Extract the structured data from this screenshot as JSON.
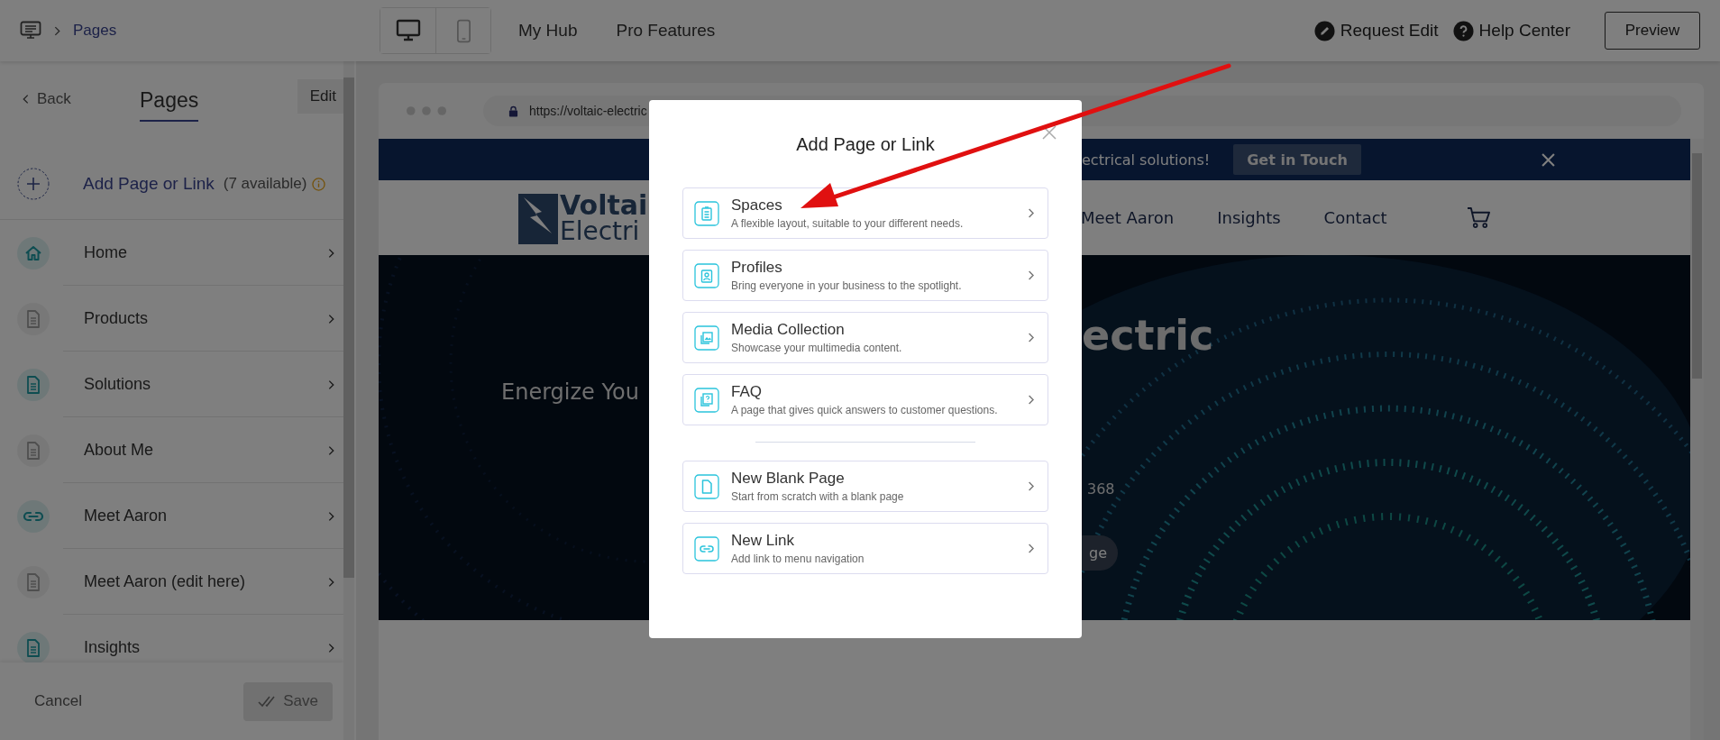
{
  "top_bar": {
    "breadcrumb_current": "Pages",
    "device_toggle": [
      {
        "kind": "desktop",
        "selected": true
      },
      {
        "kind": "mobile",
        "selected": false
      }
    ],
    "nav_links": [
      "My Hub",
      "Pro Features"
    ],
    "actions": [
      {
        "kind": "edit",
        "label": "Request Edit"
      },
      {
        "kind": "help",
        "label": "Help Center"
      }
    ],
    "preview_button": "Preview"
  },
  "sidebar": {
    "back": "Back",
    "title": "Pages",
    "edit_button": "Edit",
    "add_item": {
      "label": "Add Page or Link",
      "note": "(7 available)"
    },
    "items": [
      {
        "label": "Home",
        "kind": "home",
        "highlighted": true
      },
      {
        "label": "Products",
        "kind": "page",
        "highlighted": false
      },
      {
        "label": "Solutions",
        "kind": "page",
        "highlighted": true
      },
      {
        "label": "About Me",
        "kind": "page",
        "highlighted": false
      },
      {
        "label": "Meet Aaron",
        "kind": "link",
        "highlighted": true
      },
      {
        "label": "Meet Aaron (edit here)",
        "kind": "page",
        "highlighted": false
      },
      {
        "label": "Insights",
        "kind": "page",
        "highlighted": true
      }
    ],
    "cancel": "Cancel",
    "save": {
      "label": "Save",
      "disabled": true
    }
  },
  "preview": {
    "url": "https://voltaic-electric",
    "banner": {
      "text": "ectrical solutions!",
      "button": "Get in Touch"
    },
    "logo": [
      "Voltai",
      "Electri"
    ],
    "nav": [
      "Meet Aaron",
      "Insights",
      "Contact"
    ],
    "hero": {
      "heading": "ectric",
      "subheading": "Energize You",
      "phone": "368",
      "button": "ge"
    }
  },
  "modal": {
    "title": "Add Page or Link",
    "page_types": [
      {
        "kind": "spaces",
        "title": "Spaces",
        "description": "A flexible layout, suitable to your different needs."
      },
      {
        "kind": "profiles",
        "title": "Profiles",
        "description": "Bring everyone in your business to the spotlight."
      },
      {
        "kind": "media",
        "title": "Media Collection",
        "description": "Showcase your multimedia content."
      },
      {
        "kind": "faq",
        "title": "FAQ",
        "description": "A page that gives quick answers to customer questions."
      }
    ],
    "other_options": [
      {
        "kind": "blank",
        "title": "New Blank Page",
        "description": "Start from scratch with a blank page"
      },
      {
        "kind": "link",
        "title": "New Link",
        "description": "Add link to menu navigation"
      }
    ]
  }
}
